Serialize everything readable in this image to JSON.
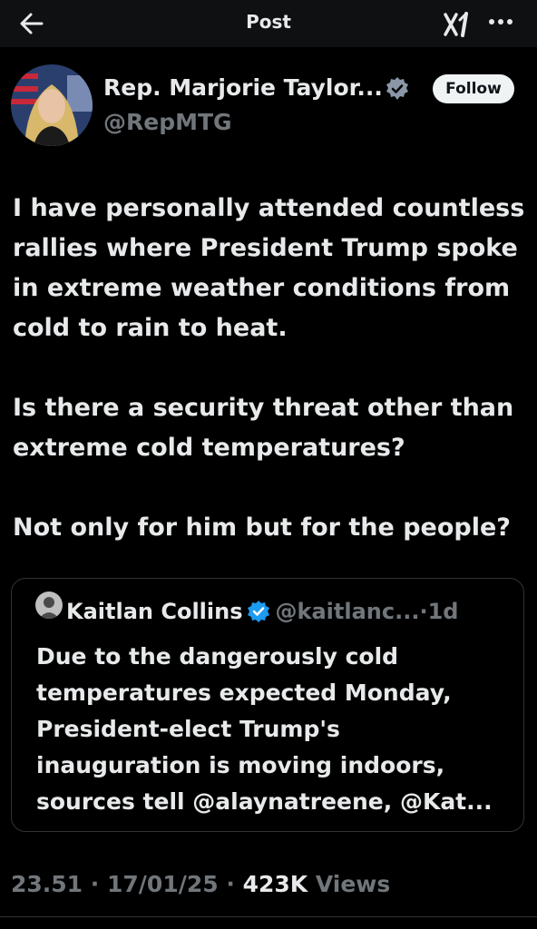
{
  "header": {
    "title": "Post"
  },
  "author": {
    "display_name": "Rep. Marjorie Taylor...",
    "handle": "@RepMTG",
    "follow_label": "Follow"
  },
  "post": {
    "paragraphs": [
      "I have personally attended countless rallies where President Trump spoke in extreme weather conditions from cold to rain to heat.",
      "Is there a security threat other than extreme cold temperatures?",
      "Not only for him but for the people?"
    ]
  },
  "quote": {
    "name": "Kaitlan Collins",
    "handle": "@kaitlanc...",
    "separator": "·",
    "time": "1d",
    "text": "Due to the dangerously cold temperatures expected Monday, President-elect Trump's inauguration is moving indoors, sources tell @alaynatreene, @Kat..."
  },
  "meta": {
    "time": "23.51",
    "separator": "·",
    "date": "17/01/25",
    "views_count": "423K",
    "views_label": "Views"
  },
  "icons": {
    "back": "back-arrow-icon",
    "grok": "grok-icon",
    "more": "more-icon",
    "verified": "verified-badge-icon"
  },
  "colors": {
    "background": "#000000",
    "text": "#e7e9ea",
    "secondary": "#71767b",
    "verified": "#1d9bf0",
    "border": "#2f3336"
  }
}
